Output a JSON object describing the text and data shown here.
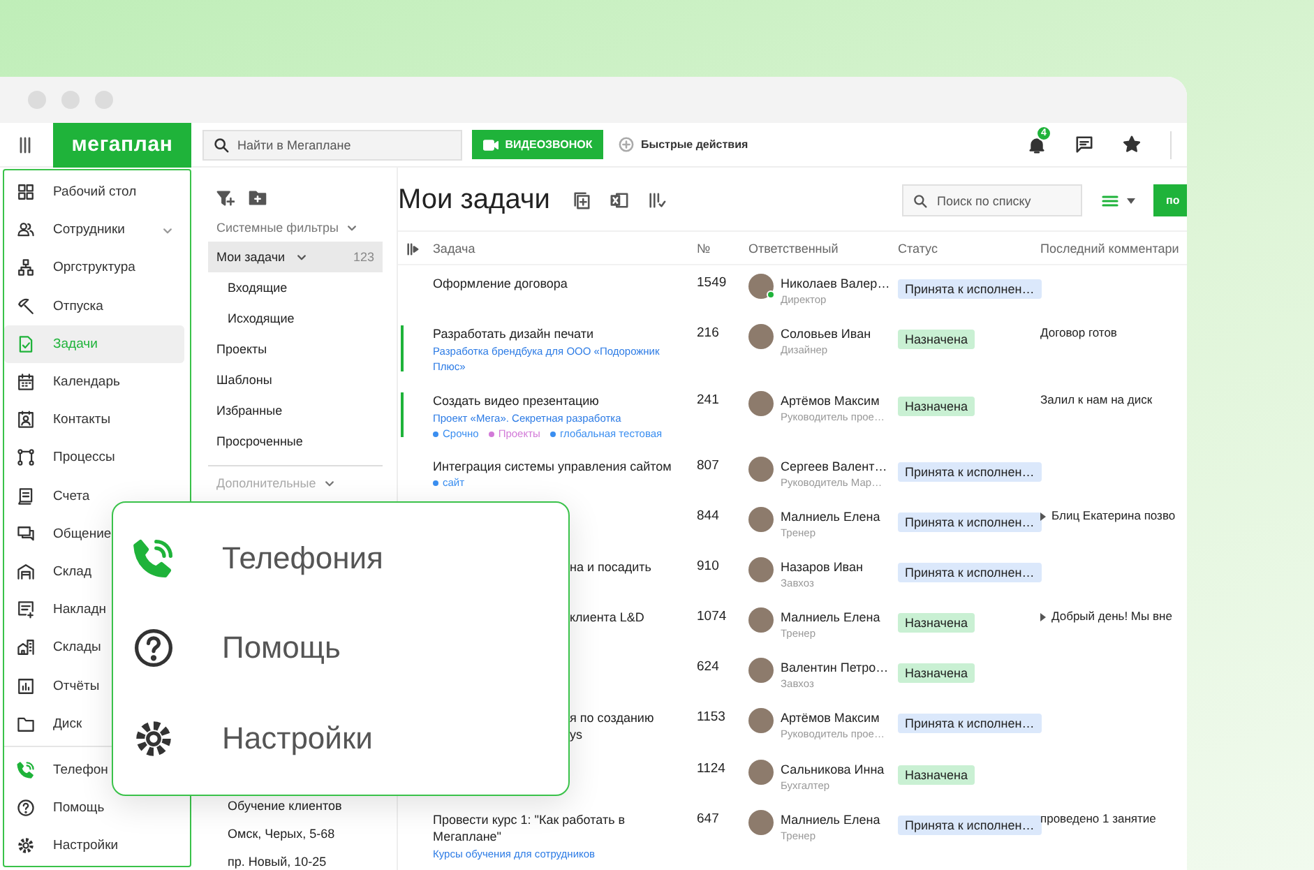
{
  "topbar": {
    "logo": "мегаплан",
    "search": {
      "placeholder": "Найти в Мегаплане"
    },
    "video_call_button": "ВИДЕОЗВОНОК",
    "quick_actions": "Быстрые действия",
    "notifications": {
      "count": "4"
    }
  },
  "sidebar": {
    "items": [
      {
        "label": "Рабочий стол",
        "selected": false,
        "expandable": false
      },
      {
        "label": "Сотрудники",
        "selected": false,
        "expandable": true
      },
      {
        "label": "Оргструктура",
        "selected": false,
        "expandable": false
      },
      {
        "label": "Отпуска",
        "selected": false,
        "expandable": false
      },
      {
        "label": "Задачи",
        "selected": true,
        "expandable": false
      },
      {
        "label": "Календарь",
        "selected": false,
        "expandable": false
      },
      {
        "label": "Контакты",
        "selected": false,
        "expandable": false
      },
      {
        "label": "Процессы",
        "selected": false,
        "expandable": false
      },
      {
        "label": "Счета",
        "selected": false,
        "expandable": false
      },
      {
        "label": "Общение",
        "selected": false,
        "expandable": false
      },
      {
        "label": "Склад",
        "selected": false,
        "expandable": false
      },
      {
        "label": "Накладн",
        "selected": false,
        "expandable": false
      },
      {
        "label": "Склады",
        "selected": false,
        "expandable": false
      },
      {
        "label": "Отчёты",
        "selected": false,
        "expandable": false
      },
      {
        "label": "Диск",
        "selected": false,
        "expandable": false
      }
    ],
    "bottom_items": [
      {
        "label": "Телефон",
        "selected": false
      },
      {
        "label": "Помощь",
        "selected": false
      },
      {
        "label": "Настройки",
        "selected": false
      }
    ]
  },
  "filters": {
    "sections": [
      {
        "title": "Системные фильтры",
        "items": [
          {
            "label": "Мои задачи",
            "count": "123",
            "selected": true,
            "children": [
              {
                "label": "Входящие",
                "selected": false
              },
              {
                "label": "Исходящие",
                "selected": false
              }
            ]
          },
          {
            "label": "Проекты",
            "selected": false
          },
          {
            "label": "Шаблоны",
            "selected": false
          },
          {
            "label": "Избранные",
            "selected": false
          },
          {
            "label": "Просроченные",
            "selected": false
          }
        ]
      },
      {
        "title": "Дополнительные",
        "items": [
          {
            "label": "Обучение клиентов",
            "selected": false
          },
          {
            "label": "Омск, Черых, 5-68",
            "selected": false
          },
          {
            "label": "пр. Новый, 10-25",
            "selected": false
          }
        ]
      }
    ]
  },
  "main": {
    "title": "Мои задачи",
    "list_search": {
      "placeholder": "Поиск по списку"
    },
    "create_button": "по"
  },
  "table": {
    "columns": [
      "Задача",
      "№",
      "Ответственный",
      "Статус",
      "Последний комментари"
    ],
    "rows": [
      {
        "covered": false,
        "flagged": false,
        "task": "Оформление договора",
        "number": "1549",
        "name": "Николаев Валер…",
        "role": "Директор",
        "online": true,
        "status": {
          "text": "Принята к исполнен…",
          "kind": "accepted"
        }
      },
      {
        "covered": false,
        "flagged": true,
        "task": "Разработать дизайн печати",
        "project": "Разработка брендбука для ООО «Подорожник Плюс»",
        "number": "216",
        "name": "Соловьев Иван",
        "role": "Дизайнер",
        "online": false,
        "status": {
          "text": "Назначена",
          "kind": "assigned"
        },
        "comment": "Договор готов"
      },
      {
        "covered": false,
        "flagged": true,
        "task": "Создать видео презентацию",
        "project": "Проект «Мега». Секретная разработка",
        "tags": [
          {
            "label": "Срочно",
            "color": "#3a8ef0"
          },
          {
            "label": "Проекты",
            "color": "#d27ad8"
          },
          {
            "label": "глобальная тестовая",
            "color": "#3a8ef0"
          }
        ],
        "number": "241",
        "name": "Артёмов Максим",
        "role": "Руководитель прое…",
        "online": false,
        "status": {
          "text": "Назначена",
          "kind": "assigned"
        },
        "comment": "Залил к нам на диск"
      },
      {
        "covered": false,
        "flagged": false,
        "task": "Интеграция системы управления сайтом",
        "tags": [
          {
            "label": "сайт",
            "color": "#3a8ef0"
          }
        ],
        "number": "807",
        "name": "Сергеев Валент…",
        "role": "Руководитель Мар…",
        "online": false,
        "status": {
          "text": "Принята к исполнен…",
          "kind": "accepted"
        }
      },
      {
        "covered": true,
        "flagged": false,
        "number": "844",
        "name": "Малниель Елена",
        "role": "Тренер",
        "online": false,
        "status": {
          "text": "Принята к исполнен…",
          "kind": "accepted"
        },
        "comment": "Блиц Екатерина позво",
        "comment_expandable": true
      },
      {
        "covered": true,
        "flagged": false,
        "task": "на и посадить",
        "number": "910",
        "name": "Назаров Иван",
        "role": "Завхоз",
        "online": false,
        "status": {
          "text": "Принята к исполнен…",
          "kind": "accepted"
        }
      },
      {
        "covered": true,
        "flagged": false,
        "task": "клиента L&D",
        "number": "1074",
        "name": "Малниель Елена",
        "role": "Тренер",
        "online": false,
        "status": {
          "text": "Назначена",
          "kind": "assigned"
        },
        "comment": "Добрый день! Мы вне",
        "comment_expandable": true
      },
      {
        "covered": true,
        "flagged": false,
        "number": "624",
        "name": "Валентин Петро…",
        "role": "Завхоз",
        "online": false,
        "status": {
          "text": "Назначена",
          "kind": "assigned"
        }
      },
      {
        "covered": true,
        "flagged": false,
        "task": "я по созданию\nys",
        "number": "1153",
        "name": "Артёмов Максим",
        "role": "Руководитель прое…",
        "online": false,
        "status": {
          "text": "Принята к исполнен…",
          "kind": "accepted"
        }
      },
      {
        "covered": true,
        "flagged": false,
        "number": "1124",
        "name": "Сальникова Инна",
        "role": "Бухгалтер",
        "online": false,
        "status": {
          "text": "Назначена",
          "kind": "assigned"
        }
      },
      {
        "covered": false,
        "flagged": false,
        "task": "Провести курс 1: \"Как работать в Мегаплане\"",
        "project": "Курсы обучения для сотрудников",
        "number": "647",
        "name": "Малниель Елена",
        "role": "Тренер",
        "online": false,
        "status": {
          "text": "Принята к исполнен…",
          "kind": "accepted"
        },
        "comment": "проведено 1 занятие"
      }
    ]
  },
  "popup": {
    "items": [
      {
        "label": "Телефония"
      },
      {
        "label": "Помощь"
      },
      {
        "label": "Настройки"
      }
    ]
  }
}
